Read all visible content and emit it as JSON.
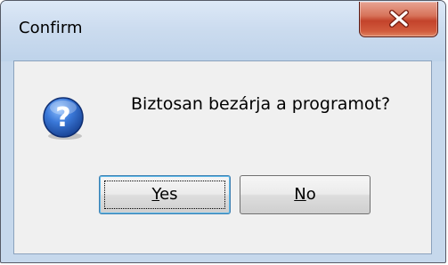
{
  "window": {
    "title": "Confirm",
    "close_icon": "close-icon"
  },
  "dialog": {
    "icon": "question-icon",
    "message": "Biztosan bezárja a programot?"
  },
  "buttons": {
    "yes": {
      "mnemonic": "Y",
      "rest": "es"
    },
    "no": {
      "mnemonic": "N",
      "rest": "o"
    }
  },
  "colors": {
    "title_bar": "#c6d8ec",
    "close_button": "#c3432b",
    "client_area": "#f0f0f0",
    "icon_blue": "#2a5fb8"
  }
}
